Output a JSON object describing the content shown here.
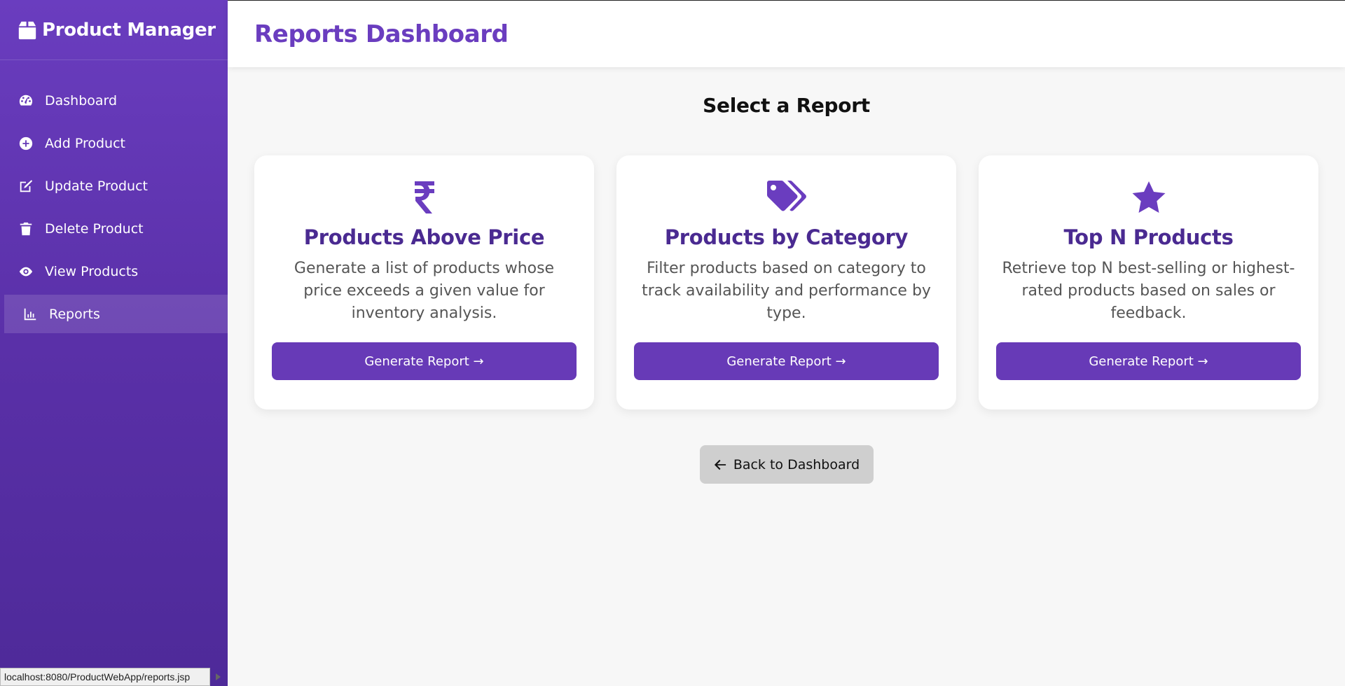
{
  "app": {
    "brand": "Product Manager",
    "brand_icon": "box-icon"
  },
  "sidebar": {
    "items": [
      {
        "label": "Dashboard",
        "icon": "gauge-icon"
      },
      {
        "label": "Add Product",
        "icon": "plus-circle-icon"
      },
      {
        "label": "Update Product",
        "icon": "edit-icon"
      },
      {
        "label": "Delete Product",
        "icon": "trash-icon"
      },
      {
        "label": "View Products",
        "icon": "eye-icon"
      },
      {
        "label": "Reports",
        "icon": "chart-bar-icon",
        "active": true
      }
    ]
  },
  "header": {
    "title": "Reports Dashboard"
  },
  "main": {
    "section_title": "Select a Report",
    "cards": [
      {
        "icon": "rupee-icon",
        "title": "Products Above Price",
        "description": "Generate a list of products whose price exceeds a given value for inventory analysis.",
        "button": "Generate Report →"
      },
      {
        "icon": "tags-icon",
        "title": "Products by Category",
        "description": "Filter products based on category to track availability and performance by type.",
        "button": "Generate Report →"
      },
      {
        "icon": "star-icon",
        "title": "Top N Products",
        "description": "Retrieve top N best-selling or highest-rated products based on sales or feedback.",
        "button": "Generate Report →"
      }
    ],
    "back_button": "Back to Dashboard"
  },
  "statusbar": {
    "url": "localhost:8080/ProductWebApp/reports.jsp"
  },
  "colors": {
    "accent": "#673ab7",
    "title": "#4a2a91",
    "sidebar": "#5a30a8",
    "back_button_bg": "#cfcfcf"
  }
}
